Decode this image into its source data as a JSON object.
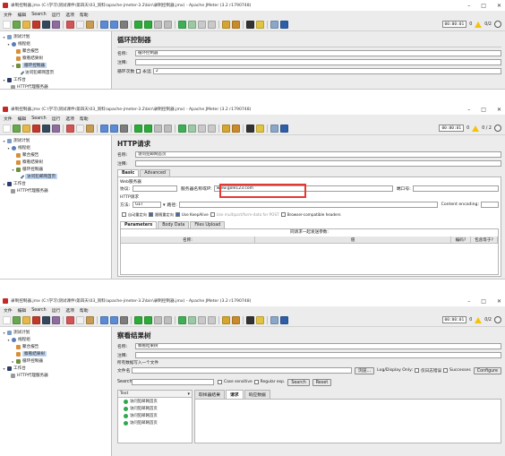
{
  "app": {
    "menu": [
      "文件",
      "编辑",
      "Search",
      "运行",
      "选项",
      "帮助"
    ],
    "window_controls": [
      "–",
      "□",
      "✕"
    ],
    "timer": "00:00:01",
    "error_count": "0",
    "thread_count_1": "0/2",
    "thread_count_2": "0 / 2",
    "thread_count_3": "0/2"
  },
  "windows": [
    {
      "title": "录制控制器.jmx (C:\\学习\\测试课件\\第四天\\03_资料\\apache-jmeter-3.2\\bin\\录制控制器.jmx) - Apache JMeter (3.2 r1790748)",
      "tree": [
        {
          "label": "测试计划",
          "level": 0,
          "icon": "flask",
          "twist": "▾"
        },
        {
          "label": "线程组",
          "level": 1,
          "icon": "gear",
          "twist": "▾"
        },
        {
          "label": "聚合报告",
          "level": 2,
          "icon": "report",
          "twist": ""
        },
        {
          "label": "察看结果树",
          "level": 2,
          "icon": "report",
          "twist": ""
        },
        {
          "label": "循环控制器",
          "level": 2,
          "icon": "loop",
          "twist": "▾",
          "selected": true
        },
        {
          "label": "访问犯邮网首页",
          "level": 3,
          "icon": "pen",
          "twist": ""
        },
        {
          "label": "工作台",
          "level": 0,
          "icon": "bench",
          "twist": "▾"
        },
        {
          "label": "HTTP代理服务器",
          "level": 1,
          "icon": "proxy",
          "twist": ""
        }
      ],
      "panel": {
        "title": "循环控制器",
        "name_label": "名称:",
        "name_value": "循环控制器",
        "comment_label": "注释:",
        "comment_value": "",
        "loop_label": "循环次数",
        "forever_label": "永远",
        "loop_value": "2"
      }
    },
    {
      "title": "录制控制器.jmx (C:\\学习\\测试课件\\第四天\\03_资料\\apache-jmeter-3.2\\bin\\录制控制器.jmx) - Apache JMeter (3.2 r1790748)",
      "tree": [
        {
          "label": "测试计划",
          "level": 0,
          "icon": "flask",
          "twist": "▾"
        },
        {
          "label": "线程组",
          "level": 1,
          "icon": "gear",
          "twist": "▾"
        },
        {
          "label": "聚合报告",
          "level": 2,
          "icon": "report",
          "twist": ""
        },
        {
          "label": "察看结果树",
          "level": 2,
          "icon": "report",
          "twist": ""
        },
        {
          "label": "循环控制器",
          "level": 2,
          "icon": "loop",
          "twist": "▾"
        },
        {
          "label": "访问犯邮网首页",
          "level": 3,
          "icon": "pen",
          "twist": "",
          "selected": true
        },
        {
          "label": "工作台",
          "level": 0,
          "icon": "bench",
          "twist": "▾"
        },
        {
          "label": "HTTP代理服务器",
          "level": 1,
          "icon": "proxy",
          "twist": ""
        }
      ],
      "panel": {
        "title": "HTTP请求",
        "name_label": "名称:",
        "name_value": "访问犯邮网首页",
        "comment_label": "注释:",
        "tab_basic": "Basic",
        "tab_advanced": "Advanced",
        "web_server": "Web服务器",
        "protocol_label": "协议:",
        "server_label": "服务器名称或IP:",
        "server_value": "www.gole123.com",
        "port_label": "端口号:",
        "http_request": "HTTP请求",
        "method_label": "方法:",
        "method_value": "GET",
        "path_label": "路径:",
        "encoding_label": "Content encoding:",
        "opt_redirect": "自动重定向",
        "opt_follow": "跟随重定向",
        "opt_keepalive": "Use KeepAlive",
        "opt_multipart": "Use multipart/form-data for POST",
        "opt_browser": "Browser-compatible headers",
        "subtab_params": "Parameters",
        "subtab_body": "Body Data",
        "subtab_files": "Files Upload",
        "params_caption": "同请求一起发送参数:",
        "col_name": "名称:",
        "col_value": "值",
        "col_encode": "编码?",
        "col_include": "包含等于?"
      }
    },
    {
      "title": "录制控制器.jmx (C:\\学习\\测试课件\\第四天\\03_资料\\apache-jmeter-3.2\\bin\\录制控制器.jmx) - Apache JMeter (3.2 r1790748)",
      "tree": [
        {
          "label": "测试计划",
          "level": 0,
          "icon": "flask",
          "twist": "▾"
        },
        {
          "label": "线程组",
          "level": 1,
          "icon": "gear",
          "twist": "▾"
        },
        {
          "label": "聚合报告",
          "level": 2,
          "icon": "report",
          "twist": ""
        },
        {
          "label": "察看结果树",
          "level": 2,
          "icon": "report",
          "twist": "",
          "selected": true
        },
        {
          "label": "循环控制器",
          "level": 2,
          "icon": "loop",
          "twist": "▸"
        },
        {
          "label": "工作台",
          "level": 0,
          "icon": "bench",
          "twist": "▾"
        },
        {
          "label": "HTTP代理服务器",
          "level": 1,
          "icon": "proxy",
          "twist": ""
        }
      ],
      "panel": {
        "title": "察看结果树",
        "name_label": "名称:",
        "name_value": "察看结果树",
        "comment_label": "注释:",
        "write_all": "所有数据写入一个文件",
        "filename_label": "文件名",
        "browse": "浏览...",
        "log_display": "Log/Display Only:",
        "only_errors": "仅日志错误",
        "successes": "Successes",
        "configure": "Configure",
        "search_label": "Search:",
        "case_sensitive": "Case sensitive",
        "regex": "Regular exp.",
        "search_btn": "Search",
        "reset_btn": "Reset",
        "renderer": "Text",
        "results": [
          "访问犯邮网首页",
          "访问犯邮网首页",
          "访问犯邮网首页",
          "访问犯邮网首页"
        ],
        "rtab_sampler": "取样器结果",
        "rtab_request": "请求",
        "rtab_response": "响应数据"
      }
    }
  ]
}
